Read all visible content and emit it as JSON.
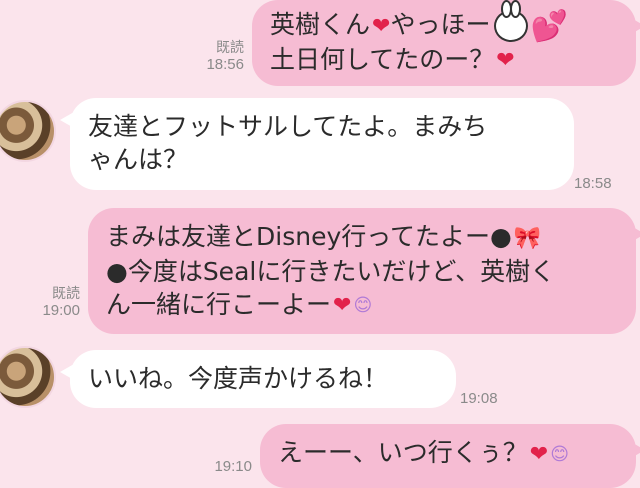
{
  "messages": [
    {
      "side": "sent",
      "lines": [
        "英樹くん",
        "土日何してたのー？"
      ],
      "line1_tail": "やっほー",
      "read_label": "既読",
      "time": "18:56"
    },
    {
      "side": "received",
      "lines": [
        "友達とフットサルしてたよ。まみち",
        "ゃんは？"
      ],
      "time": "18:58"
    },
    {
      "side": "sent",
      "lines": [
        "まみは友達とDisney行ってたよー●",
        "●今度はSealに行きたいだけど、英樹く",
        "ん一緒に行こーよー"
      ],
      "read_label": "既読",
      "time": "19:00"
    },
    {
      "side": "received",
      "lines": [
        "いいね。今度声かけるね！"
      ],
      "time": "19:08"
    },
    {
      "side": "sent",
      "lines": [
        "えーー、いつ行くぅ？"
      ],
      "time": "19:10"
    }
  ],
  "icons": {
    "heart": "❤",
    "big_heart": "💕",
    "ribbon": "🎀",
    "smile": "😊"
  },
  "colors": {
    "background": "#fbe4ec",
    "sent_bubble": "#f6bcd3",
    "received_bubble": "#ffffff",
    "heart": "#e2224b"
  }
}
